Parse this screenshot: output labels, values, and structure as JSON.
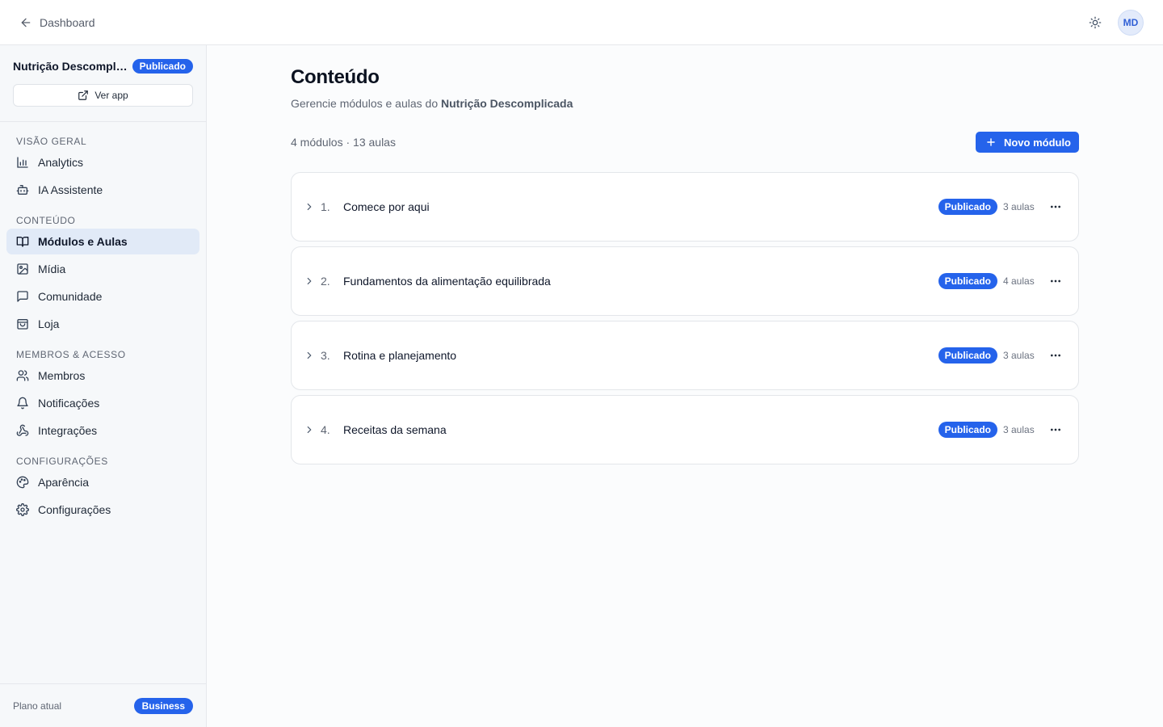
{
  "topbar": {
    "back_label": "Dashboard",
    "avatar_initials": "MD"
  },
  "sidebar": {
    "app_name": "Nutrição Descomplicada",
    "app_status": "Publicado",
    "view_app_label": "Ver app",
    "sections": [
      {
        "title": "VISÃO GERAL",
        "items": [
          {
            "label": "Analytics",
            "icon": "bar-chart-icon"
          },
          {
            "label": "IA Assistente",
            "icon": "bot-icon"
          }
        ]
      },
      {
        "title": "CONTEÚDO",
        "items": [
          {
            "label": "Módulos e Aulas",
            "icon": "book-open-icon",
            "active": true
          },
          {
            "label": "Mídia",
            "icon": "image-icon"
          },
          {
            "label": "Comunidade",
            "icon": "message-square-icon"
          },
          {
            "label": "Loja",
            "icon": "shopping-bag-icon"
          }
        ]
      },
      {
        "title": "MEMBROS & ACESSO",
        "items": [
          {
            "label": "Membros",
            "icon": "users-icon"
          },
          {
            "label": "Notificações",
            "icon": "bell-icon"
          },
          {
            "label": "Integrações",
            "icon": "webhook-icon"
          }
        ]
      },
      {
        "title": "CONFIGURAÇÕES",
        "items": [
          {
            "label": "Aparência",
            "icon": "palette-icon"
          },
          {
            "label": "Configurações",
            "icon": "gear-icon"
          }
        ]
      }
    ],
    "plan_label": "Plano atual",
    "plan_name": "Business"
  },
  "main": {
    "title": "Conteúdo",
    "subtitle_prefix": "Gerencie módulos e aulas do",
    "subtitle_app": "Nutrição Descomplicada",
    "counts": "4 módulos · 13 aulas",
    "new_module_label": "Novo módulo",
    "modules": [
      {
        "number": "1.",
        "title": "Comece por aqui",
        "status": "Publicado",
        "lessons": "3 aulas"
      },
      {
        "number": "2.",
        "title": "Fundamentos da alimentação equilibrada",
        "status": "Publicado",
        "lessons": "4 aulas"
      },
      {
        "number": "3.",
        "title": "Rotina e planejamento",
        "status": "Publicado",
        "lessons": "3 aulas"
      },
      {
        "number": "4.",
        "title": "Receitas da semana",
        "status": "Publicado",
        "lessons": "3 aulas"
      }
    ]
  },
  "colors": {
    "accent": "#2563eb",
    "active_nav_bg": "#e1eaf7",
    "sidebar_bg": "#f6f8fa"
  }
}
